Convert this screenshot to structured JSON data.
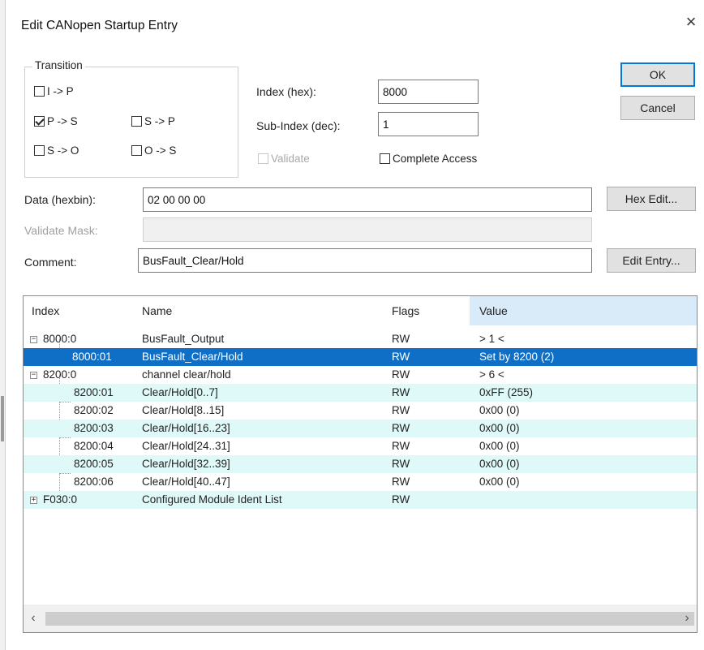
{
  "dialog": {
    "title": "Edit CANopen Startup Entry",
    "close_glyph": "×"
  },
  "transition": {
    "label": "Transition",
    "options": [
      {
        "label": "I -> P",
        "checked": false
      },
      {
        "label": "P -> S",
        "checked": true
      },
      {
        "label": "S -> P",
        "checked": false
      },
      {
        "label": "S -> O",
        "checked": false
      },
      {
        "label": "O -> S",
        "checked": false
      }
    ]
  },
  "index": {
    "label": "Index (hex):",
    "value": "8000"
  },
  "subindex": {
    "label": "Sub-Index (dec):",
    "value": "1"
  },
  "validate": {
    "label": "Validate",
    "checked": false,
    "enabled": false
  },
  "complete_access": {
    "label": "Complete Access",
    "checked": false
  },
  "data": {
    "label": "Data (hexbin):",
    "value": "02 00 00 00"
  },
  "validate_mask": {
    "label": "Validate Mask:",
    "value": ""
  },
  "comment": {
    "label": "Comment:",
    "value": "BusFault_Clear/Hold"
  },
  "buttons": {
    "ok": "OK",
    "cancel": "Cancel",
    "hex_edit": "Hex Edit...",
    "edit_entry": "Edit Entry..."
  },
  "table": {
    "columns": [
      "Index",
      "Name",
      "Flags",
      "Value"
    ],
    "rows": [
      {
        "index": "8000:0",
        "name": "BusFault_Output",
        "flags": "RW",
        "value": "> 1 <",
        "level": 0,
        "toggle": "−"
      },
      {
        "index": "8000:01",
        "name": "BusFault_Clear/Hold",
        "flags": "RW",
        "value": "Set by 8200 (2)",
        "level": 1,
        "toggle": ""
      },
      {
        "index": "8200:0",
        "name": "channel clear/hold",
        "flags": "RW",
        "value": "> 6 <",
        "level": 0,
        "toggle": "−"
      },
      {
        "index": "8200:01",
        "name": "Clear/Hold[0..7]",
        "flags": "RW",
        "value": "0xFF (255)",
        "level": 1,
        "toggle": ""
      },
      {
        "index": "8200:02",
        "name": "Clear/Hold[8..15]",
        "flags": "RW",
        "value": "0x00 (0)",
        "level": 1,
        "toggle": ""
      },
      {
        "index": "8200:03",
        "name": "Clear/Hold[16..23]",
        "flags": "RW",
        "value": "0x00 (0)",
        "level": 1,
        "toggle": ""
      },
      {
        "index": "8200:04",
        "name": "Clear/Hold[24..31]",
        "flags": "RW",
        "value": "0x00 (0)",
        "level": 1,
        "toggle": ""
      },
      {
        "index": "8200:05",
        "name": "Clear/Hold[32..39]",
        "flags": "RW",
        "value": "0x00 (0)",
        "level": 1,
        "toggle": ""
      },
      {
        "index": "8200:06",
        "name": "Clear/Hold[40..47]",
        "flags": "RW",
        "value": "0x00 (0)",
        "level": 1,
        "toggle": ""
      },
      {
        "index": "F030:0",
        "name": "Configured Module Ident List",
        "flags": "RW",
        "value": "",
        "level": 0,
        "toggle": "+"
      }
    ]
  },
  "scrollbar": {
    "left_arrow": "‹",
    "right_arrow": "›"
  },
  "colors": {
    "selection": "#0f6fc6",
    "highlight_row": "#dff8f8",
    "default_button_border": "#0078d7"
  }
}
